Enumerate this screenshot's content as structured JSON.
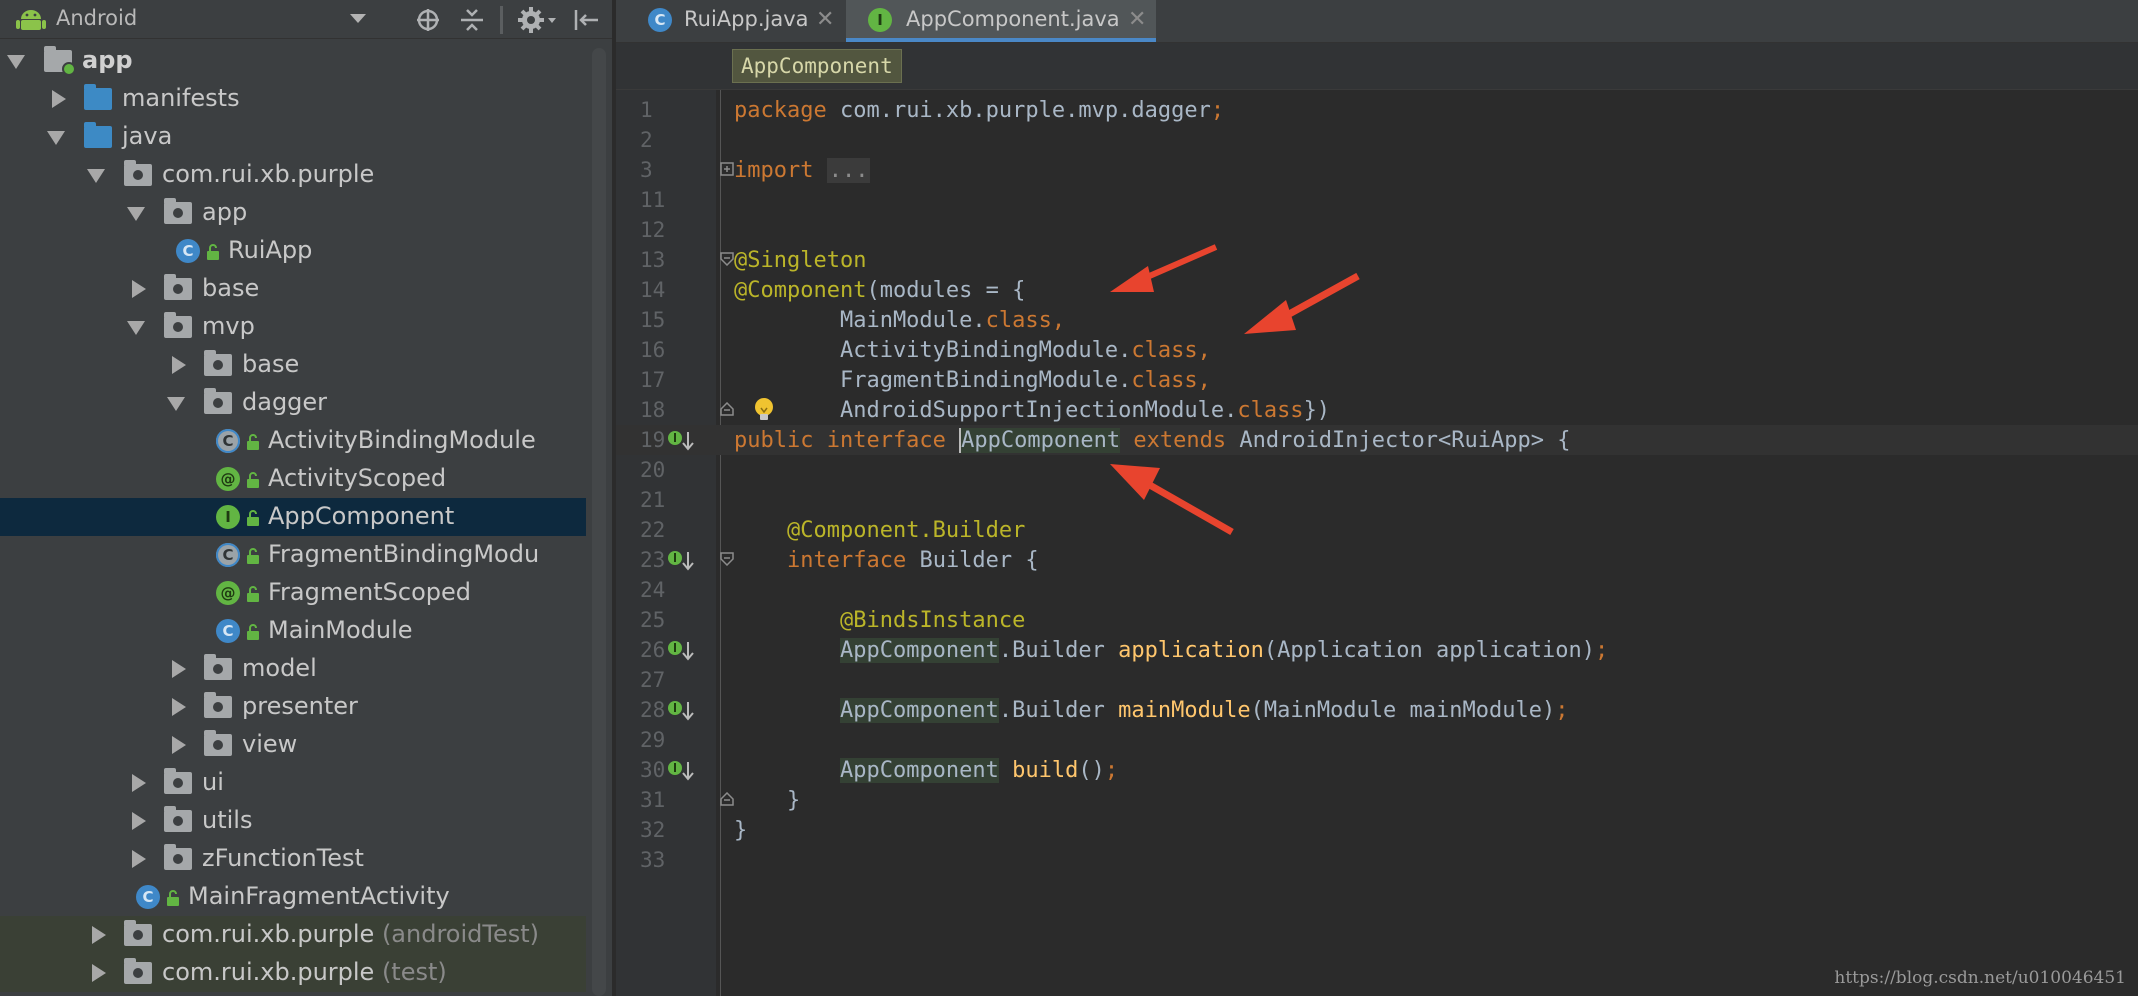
{
  "project_panel": {
    "view_selector": "Android",
    "header_icons": [
      "target-icon",
      "collapse-all-icon",
      "settings-icon",
      "hide-panel-icon"
    ]
  },
  "tree": [
    {
      "label": "app",
      "depth": 0,
      "icon": "module-folder-icon",
      "expanded": true,
      "bold": true
    },
    {
      "label": "manifests",
      "depth": 1,
      "icon": "folder-icon",
      "expanded": false
    },
    {
      "label": "java",
      "depth": 1,
      "icon": "folder-icon",
      "expanded": true
    },
    {
      "label": "com.rui.xb.purple",
      "depth": 2,
      "icon": "package-icon",
      "expanded": true
    },
    {
      "label": "app",
      "depth": 3,
      "icon": "package-icon",
      "expanded": true
    },
    {
      "label": "RuiApp",
      "depth": 4,
      "icon": "class-icon",
      "leaf": true
    },
    {
      "label": "base",
      "depth": 3,
      "icon": "package-icon",
      "expanded": false
    },
    {
      "label": "mvp",
      "depth": 3,
      "icon": "package-icon",
      "expanded": true
    },
    {
      "label": "base",
      "depth": 4,
      "icon": "package-icon",
      "expanded": false
    },
    {
      "label": "dagger",
      "depth": 4,
      "icon": "package-icon",
      "expanded": true
    },
    {
      "label": "ActivityBindingModule",
      "depth": 5,
      "icon": "abstract-class-icon",
      "leaf": true
    },
    {
      "label": "ActivityScoped",
      "depth": 5,
      "icon": "annotation-icon",
      "leaf": true
    },
    {
      "label": "AppComponent",
      "depth": 5,
      "icon": "interface-icon",
      "leaf": true,
      "selected": true
    },
    {
      "label": "FragmentBindingModu",
      "depth": 5,
      "icon": "abstract-class-icon",
      "leaf": true
    },
    {
      "label": "FragmentScoped",
      "depth": 5,
      "icon": "annotation-icon",
      "leaf": true
    },
    {
      "label": "MainModule",
      "depth": 5,
      "icon": "class-icon",
      "leaf": true
    },
    {
      "label": "model",
      "depth": 4,
      "icon": "package-icon",
      "expanded": false
    },
    {
      "label": "presenter",
      "depth": 4,
      "icon": "package-icon",
      "expanded": false
    },
    {
      "label": "view",
      "depth": 4,
      "icon": "package-icon",
      "expanded": false
    },
    {
      "label": "ui",
      "depth": 3,
      "icon": "package-icon",
      "expanded": false
    },
    {
      "label": "utils",
      "depth": 3,
      "icon": "package-icon",
      "expanded": false
    },
    {
      "label": "zFunctionTest",
      "depth": 3,
      "icon": "package-icon",
      "expanded": false
    },
    {
      "label": "MainFragmentActivity",
      "depth": 3,
      "icon": "class-icon",
      "leaf": true
    },
    {
      "label": "com.rui.xb.purple",
      "suffix": "(androidTest)",
      "depth": 2,
      "icon": "package-icon",
      "expanded": false,
      "test": true
    },
    {
      "label": "com.rui.xb.purple",
      "suffix": "(test)",
      "depth": 2,
      "icon": "package-icon",
      "expanded": false,
      "test": true
    }
  ],
  "tabs": [
    {
      "label": "RuiApp.java",
      "icon": "class-icon",
      "active": false
    },
    {
      "label": "AppComponent.java",
      "icon": "interface-icon",
      "active": true
    }
  ],
  "breadcrumb": "AppComponent",
  "code_lines": [
    {
      "n": "1",
      "html": "<span class=\"kw\">package</span> com.rui.xb.purple.mvp.dagger<span class=\"kw\">;</span>"
    },
    {
      "n": "2",
      "html": ""
    },
    {
      "n": "3",
      "html": "<span class=\"kw\">import</span> <span class=\"fold-dots\">...</span>",
      "fold": "plus"
    },
    {
      "n": "11",
      "html": ""
    },
    {
      "n": "12",
      "html": ""
    },
    {
      "n": "13",
      "html": "<span class=\"an\">@Singleton</span>",
      "fold": "open"
    },
    {
      "n": "14",
      "html": "<span class=\"an\">@Component</span>(modules = {"
    },
    {
      "n": "15",
      "html": "        MainModule.<span class=\"kw\">class,</span>"
    },
    {
      "n": "16",
      "html": "        ActivityBindingModule.<span class=\"kw\">class,</span>"
    },
    {
      "n": "17",
      "html": "        FragmentBindingModule.<span class=\"kw\">class,</span>"
    },
    {
      "n": "18",
      "html": "        AndroidSupportInjectionModule.<span class=\"kw\">class</span>})",
      "fold": "close",
      "bulb": true
    },
    {
      "n": "19",
      "html": "<span class=\"kw\">public interface</span> <span class=\"caret\"></span><span class=\"hl\">AppComponent</span> <span class=\"kw\">extends</span> AndroidInjector&lt;RuiApp&gt; {",
      "current": true,
      "gutter": "implemented-icon"
    },
    {
      "n": "20",
      "html": ""
    },
    {
      "n": "21",
      "html": ""
    },
    {
      "n": "22",
      "html": "    <span class=\"an\">@Component.Builder</span>"
    },
    {
      "n": "23",
      "html": "    <span class=\"kw\">interface</span> Builder {",
      "fold": "open",
      "gutter": "implemented-icon"
    },
    {
      "n": "24",
      "html": ""
    },
    {
      "n": "25",
      "html": "        <span class=\"an\">@BindsInstance</span>"
    },
    {
      "n": "26",
      "html": "        <span class=\"hl\">AppComponent</span>.Builder <span class=\"fn\">application</span>(Application application)<span class=\"kw\">;</span>",
      "gutter": "implemented-icon"
    },
    {
      "n": "27",
      "html": ""
    },
    {
      "n": "28",
      "html": "        <span class=\"hl\">AppComponent</span>.Builder <span class=\"fn\">mainModule</span>(MainModule mainModule)<span class=\"kw\">;</span>",
      "gutter": "implemented-icon"
    },
    {
      "n": "29",
      "html": ""
    },
    {
      "n": "30",
      "html": "        <span class=\"hl\">AppComponent</span> <span class=\"fn\">build</span>()<span class=\"kw\">;</span>",
      "gutter": "implemented-icon"
    },
    {
      "n": "31",
      "html": "    }",
      "fold": "close"
    },
    {
      "n": "32",
      "html": "}"
    },
    {
      "n": "33",
      "html": ""
    }
  ],
  "annotation_color": "#e8442e",
  "watermark": "https://blog.csdn.net/u010046451"
}
